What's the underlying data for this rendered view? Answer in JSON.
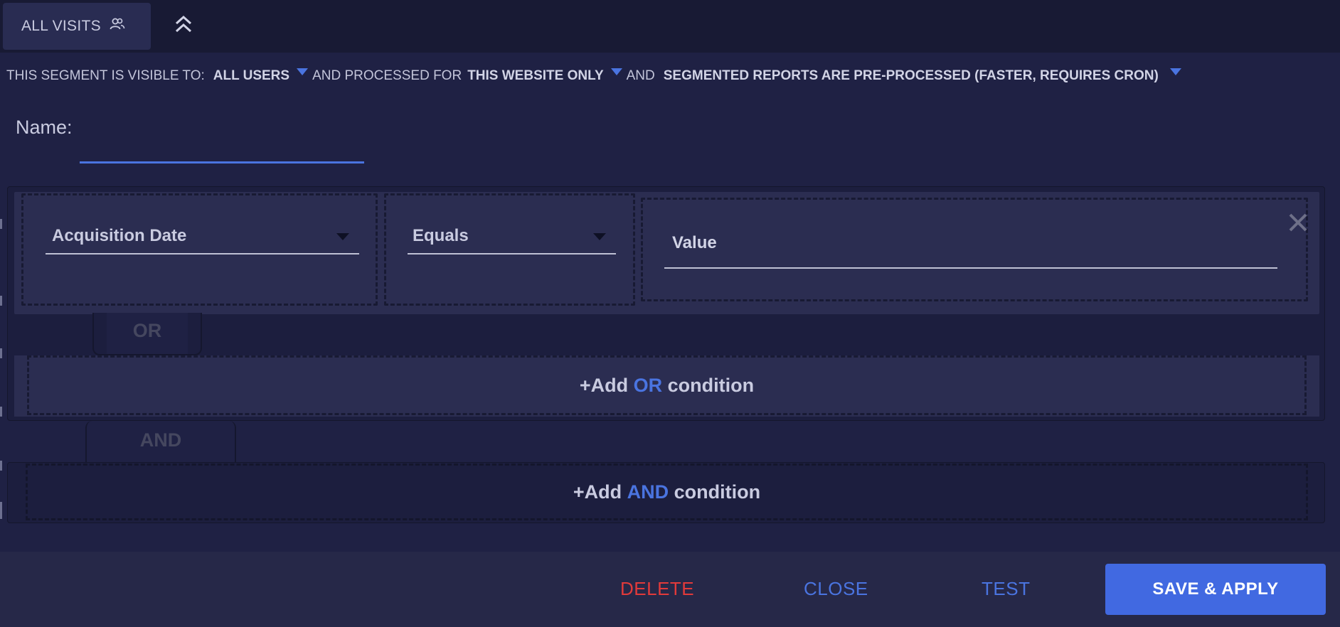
{
  "header": {
    "segment_tab_label": "ALL VISITS",
    "segment_tab_icon": "users-icon",
    "collapse_icon": "double-chevron-up-icon"
  },
  "visibility": {
    "prefix": "THIS SEGMENT IS VISIBLE TO:",
    "visible_to": "ALL USERS",
    "processed_for_label": "AND PROCESSED FOR",
    "processed_for": "THIS WEBSITE ONLY",
    "and_label": "AND",
    "processing": "SEGMENTED REPORTS ARE PRE-PROCESSED (FASTER, REQUIRES CRON)"
  },
  "name_field": {
    "label": "Name:",
    "value": ""
  },
  "conditions": [
    {
      "dimension": "Acquisition Date",
      "operator": "Equals",
      "value_placeholder": "Value"
    }
  ],
  "connectors": {
    "or": "OR",
    "and": "AND"
  },
  "add_or": {
    "prefix": "+Add",
    "keyword": "OR",
    "suffix": "condition"
  },
  "add_and": {
    "prefix": "+Add",
    "keyword": "AND",
    "suffix": "condition"
  },
  "footer": {
    "delete": "DELETE",
    "close": "CLOSE",
    "test": "TEST",
    "save_apply": "SAVE & APPLY"
  },
  "colors": {
    "accent": "#4a74e0",
    "danger": "#e23a3a",
    "background": "#1f2144",
    "panel": "#2b2d51"
  }
}
